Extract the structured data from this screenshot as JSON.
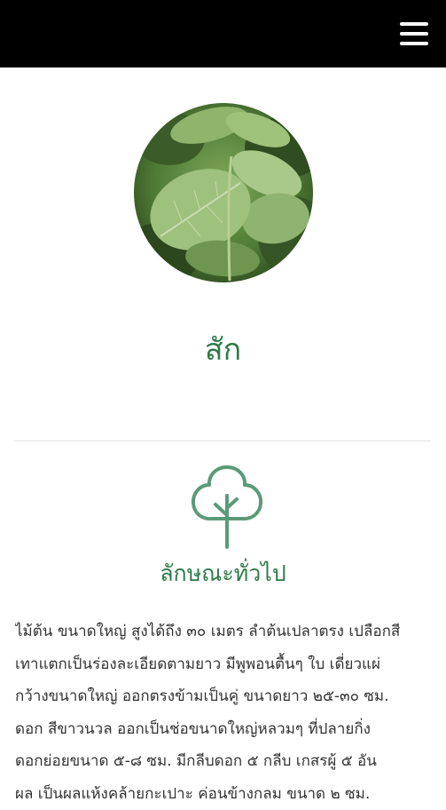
{
  "header": {
    "menu_icon": "hamburger-menu-icon"
  },
  "plant": {
    "image_subject": "teak leaves photo",
    "name": "สัก"
  },
  "section": {
    "icon": "tree-icon",
    "heading": "ลักษณะทั่วไป",
    "lines": [
      "ไม้ต้น ขนาดใหญ่ สูงได้ถึง ๓๐ เมตร ลำต้นเปลาตรง เปลือกสี",
      "เทาแตกเป็นร่องละเอียดตามยาว มีพูพอนตื้นๆ ใบ เดี่ยวแผ่",
      "กว้างขนาดใหญ่ ออกตรงข้ามเป็นคู่ ขนาดยาว ๒๕-๓๐ ซม.",
      "ดอก สีขาวนวล ออกเป็นช่อขนาดใหญ่หลวมๆ ที่ปลายกิ่ง",
      "ดอกย่อยขนาด ๕-๘ ซม. มีกลีบดอก ๕ กลีบ เกสรผู้ ๕ อัน",
      "ผล เป็นผลแห้งคล้ายกะเปาะ ค่อนข้างกลม ขนาด ๒ ซม."
    ]
  },
  "colors": {
    "accent_green": "#2e7a48",
    "icon_green": "#5a9a78",
    "topbar": "#000000"
  }
}
